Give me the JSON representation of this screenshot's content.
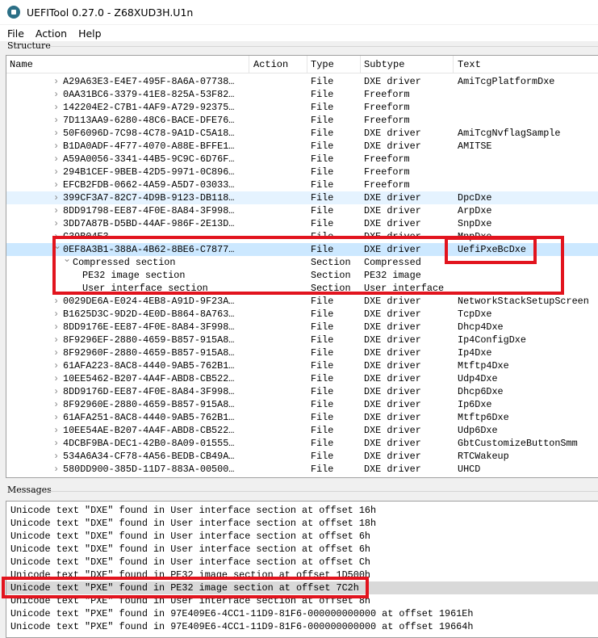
{
  "window": {
    "title": "UEFITool 0.27.0 - Z68XUD3H.U1n"
  },
  "menu": [
    "File",
    "Action",
    "Help"
  ],
  "structure": {
    "label": "Structure",
    "columns": [
      "Name",
      "Action",
      "Type",
      "Subtype",
      "Text"
    ],
    "rows": [
      {
        "name": "A29A63E3-E4E7-495F-8A6A-07738…",
        "type": "File",
        "subtype": "DXE driver",
        "text": "AmiTcgPlatformDxe",
        "level": 0,
        "exp": "collapsed"
      },
      {
        "name": "0AA31BC6-3379-41E8-825A-53F82…",
        "type": "File",
        "subtype": "Freeform",
        "text": "",
        "level": 0,
        "exp": "collapsed"
      },
      {
        "name": "142204E2-C7B1-4AF9-A729-92375…",
        "type": "File",
        "subtype": "Freeform",
        "text": "",
        "level": 0,
        "exp": "collapsed"
      },
      {
        "name": "7D113AA9-6280-48C6-BACE-DFE76…",
        "type": "File",
        "subtype": "Freeform",
        "text": "",
        "level": 0,
        "exp": "collapsed"
      },
      {
        "name": "50F6096D-7C98-4C78-9A1D-C5A18…",
        "type": "File",
        "subtype": "DXE driver",
        "text": "AmiTcgNvflagSample",
        "level": 0,
        "exp": "collapsed"
      },
      {
        "name": "B1DA0ADF-4F77-4070-A88E-BFFE1…",
        "type": "File",
        "subtype": "DXE driver",
        "text": "AMITSE",
        "level": 0,
        "exp": "collapsed"
      },
      {
        "name": "A59A0056-3341-44B5-9C9C-6D76F…",
        "type": "File",
        "subtype": "Freeform",
        "text": "",
        "level": 0,
        "exp": "collapsed"
      },
      {
        "name": "294B1CEF-9BEB-42D5-9971-0C896…",
        "type": "File",
        "subtype": "Freeform",
        "text": "",
        "level": 0,
        "exp": "collapsed"
      },
      {
        "name": "EFCB2FDB-0662-4A59-A5D7-03033…",
        "type": "File",
        "subtype": "Freeform",
        "text": "",
        "level": 0,
        "exp": "collapsed"
      },
      {
        "name": "399CF3A7-82C7-4D9B-9123-DB118…",
        "type": "File",
        "subtype": "DXE driver",
        "text": "DpcDxe",
        "level": 0,
        "exp": "collapsed",
        "state": "hover"
      },
      {
        "name": "8DD91798-EE87-4F0E-8A84-3F998…",
        "type": "File",
        "subtype": "DXE driver",
        "text": "ArpDxe",
        "level": 0,
        "exp": "collapsed"
      },
      {
        "name": "3DD7A87B-D5BD-44AF-986F-2E13D…",
        "type": "File",
        "subtype": "DXE driver",
        "text": "SnpDxe",
        "level": 0,
        "exp": "collapsed"
      },
      {
        "type": "File",
        "subtype": "DXE driver",
        "text": "MnpDxe",
        "level": 0,
        "exp": "collapsed"
      },
      {
        "name": "0EF8A3B1-388A-4B62-8BE6-C7877…",
        "type": "File",
        "subtype": "DXE driver",
        "text": "UefiPxeBcDxe",
        "level": 0,
        "exp": "expanded",
        "state": "selected"
      },
      {
        "name": "Compressed section",
        "type": "Section",
        "subtype": "Compressed",
        "text": "",
        "level": 1,
        "exp": "expanded"
      },
      {
        "name": "PE32 image section",
        "type": "Section",
        "subtype": "PE32 image",
        "text": "",
        "level": 2,
        "exp": "none"
      },
      {
        "name": "User interface section",
        "type": "Section",
        "subtype": "User interface",
        "text": "",
        "level": 2,
        "exp": "none"
      },
      {
        "name": "0029DE6A-E024-4EB8-A91D-9F23A…",
        "type": "File",
        "subtype": "DXE driver",
        "text": "NetworkStackSetupScreen",
        "level": 0,
        "exp": "collapsed"
      },
      {
        "name": "B1625D3C-9D2D-4E0D-B864-8A763…",
        "type": "File",
        "subtype": "DXE driver",
        "text": "TcpDxe",
        "level": 0,
        "exp": "collapsed"
      },
      {
        "name": "8DD9176E-EE87-4F0E-8A84-3F998…",
        "type": "File",
        "subtype": "DXE driver",
        "text": "Dhcp4Dxe",
        "level": 0,
        "exp": "collapsed"
      },
      {
        "name": "8F9296EF-2880-4659-B857-915A8…",
        "type": "File",
        "subtype": "DXE driver",
        "text": "Ip4ConfigDxe",
        "level": 0,
        "exp": "collapsed"
      },
      {
        "name": "8F92960F-2880-4659-B857-915A8…",
        "type": "File",
        "subtype": "DXE driver",
        "text": "Ip4Dxe",
        "level": 0,
        "exp": "collapsed"
      },
      {
        "name": "61AFA223-8AC8-4440-9AB5-762B1…",
        "type": "File",
        "subtype": "DXE driver",
        "text": "Mtftp4Dxe",
        "level": 0,
        "exp": "collapsed"
      },
      {
        "name": "10EE5462-B207-4A4F-ABD8-CB522…",
        "type": "File",
        "subtype": "DXE driver",
        "text": "Udp4Dxe",
        "level": 0,
        "exp": "collapsed"
      },
      {
        "name": "8DD9176D-EE87-4F0E-8A84-3F998…",
        "type": "File",
        "subtype": "DXE driver",
        "text": "Dhcp6Dxe",
        "level": 0,
        "exp": "collapsed"
      },
      {
        "name": "8F92960E-2880-4659-B857-915A8…",
        "type": "File",
        "subtype": "DXE driver",
        "text": "Ip6Dxe",
        "level": 0,
        "exp": "collapsed"
      },
      {
        "name": "61AFA251-8AC8-4440-9AB5-762B1…",
        "type": "File",
        "subtype": "DXE driver",
        "text": "Mtftp6Dxe",
        "level": 0,
        "exp": "collapsed"
      },
      {
        "name": "10EE54AE-B207-4A4F-ABD8-CB522…",
        "type": "File",
        "subtype": "DXE driver",
        "text": "Udp6Dxe",
        "level": 0,
        "exp": "collapsed"
      },
      {
        "name": "4DCBF9BA-DEC1-42B0-8A09-01555…",
        "type": "File",
        "subtype": "DXE driver",
        "text": "GbtCustomizeButtonSmm",
        "level": 0,
        "exp": "collapsed"
      },
      {
        "name": "534A6A34-CF78-4A56-BEDB-CB49A…",
        "type": "File",
        "subtype": "DXE driver",
        "text": "RTCWakeup",
        "level": 0,
        "exp": "collapsed"
      },
      {
        "name": "580DD900-385D-11D7-883A-00500…",
        "type": "File",
        "subtype": "DXE driver",
        "text": "UHCD",
        "level": 0,
        "exp": "collapsed"
      }
    ]
  },
  "messages": {
    "label": "Messages",
    "items": [
      "Unicode text \"DXE\" found in User interface section at offset 16h",
      "Unicode text \"DXE\" found in User interface section at offset 18h",
      "Unicode text \"DXE\" found in User interface section at offset 6h",
      "Unicode text \"DXE\" found in User interface section at offset 6h",
      "Unicode text \"DXE\" found in User interface section at offset Ch",
      "Unicode text \"DXE\" found in PE32 image section at offset 1D500h",
      "Unicode text \"PXE\" found in PE32 image section at offset 7C2h",
      "Unicode text \"PXE\" found in User interface section at offset 8h",
      "Unicode text \"PXE\" found in 97E409E6-4CC1-11D9-81F6-000000000000 at offset 1961Eh",
      "Unicode text \"PXE\" found in 97E409E6-4CC1-11D9-81F6-000000000000 at offset 19664h"
    ],
    "selected_index": 6
  },
  "colors": {
    "highlight": "#e2141e",
    "selected_row": "#cce8ff",
    "hover_row": "#e5f3ff",
    "message_selected": "#d9d9d9"
  }
}
